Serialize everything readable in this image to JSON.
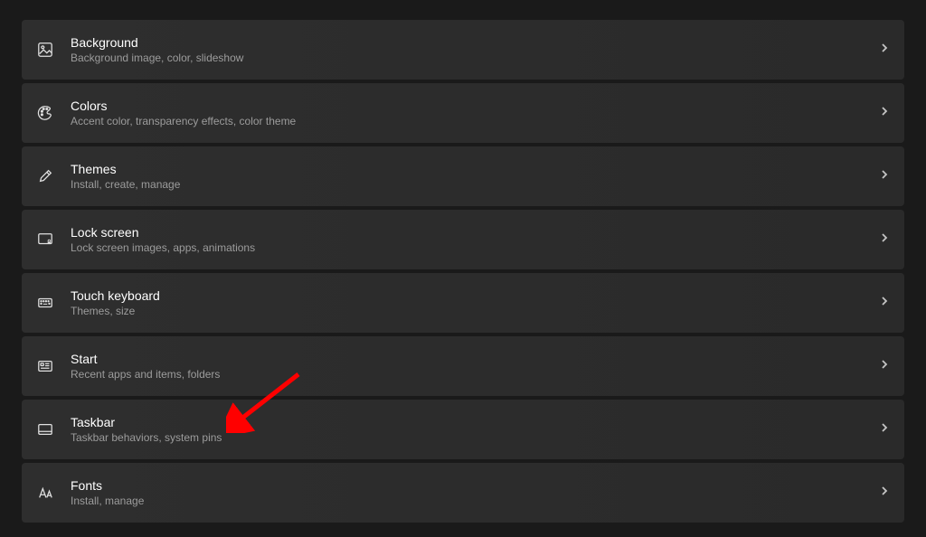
{
  "items": [
    {
      "id": "background",
      "title": "Background",
      "subtitle": "Background image, color, slideshow"
    },
    {
      "id": "colors",
      "title": "Colors",
      "subtitle": "Accent color, transparency effects, color theme"
    },
    {
      "id": "themes",
      "title": "Themes",
      "subtitle": "Install, create, manage"
    },
    {
      "id": "lock-screen",
      "title": "Lock screen",
      "subtitle": "Lock screen images, apps, animations"
    },
    {
      "id": "touch-keyboard",
      "title": "Touch keyboard",
      "subtitle": "Themes, size"
    },
    {
      "id": "start",
      "title": "Start",
      "subtitle": "Recent apps and items, folders"
    },
    {
      "id": "taskbar",
      "title": "Taskbar",
      "subtitle": "Taskbar behaviors, system pins"
    },
    {
      "id": "fonts",
      "title": "Fonts",
      "subtitle": "Install, manage"
    }
  ]
}
